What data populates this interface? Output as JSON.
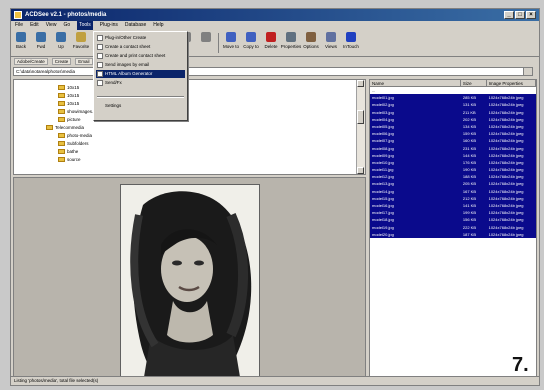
{
  "window": {
    "title": "ACDSee v2.1 - photos/media",
    "controls": [
      "_",
      "□",
      "×"
    ]
  },
  "menubar": [
    "File",
    "Edit",
    "View",
    "Go",
    "Tools",
    "Plug-ins",
    "Database",
    "Help"
  ],
  "toolbar": [
    {
      "label": "Back",
      "icon": "back-icon",
      "color": "#3a6ea5"
    },
    {
      "label": "Fwd",
      "icon": "forward-icon",
      "color": "#3a6ea5"
    },
    {
      "label": "Up",
      "icon": "up-icon",
      "color": "#3a6ea5"
    },
    {
      "label": "Favorite",
      "icon": "favorite-icon",
      "color": "#c0a040"
    },
    {
      "label": "View",
      "icon": "view-icon",
      "color": "#6080a0"
    },
    {
      "label": "",
      "icon": "icon",
      "color": "#808080"
    },
    {
      "label": "",
      "icon": "icon",
      "color": "#808080"
    },
    {
      "label": "",
      "icon": "icon",
      "color": "#808080"
    },
    {
      "label": "",
      "icon": "icon",
      "color": "#808080"
    },
    {
      "label": "",
      "icon": "icon",
      "color": "#808080"
    },
    {
      "label": "Move to",
      "icon": "move-to-icon",
      "color": "#4060c0"
    },
    {
      "label": "Copy to",
      "icon": "copy-to-icon",
      "color": "#4060c0"
    },
    {
      "label": "Delete",
      "icon": "delete-icon",
      "color": "#c02020"
    },
    {
      "label": "Properties",
      "icon": "properties-icon",
      "color": "#607080"
    },
    {
      "label": "Options",
      "icon": "options-icon",
      "color": "#806040"
    },
    {
      "label": "Views",
      "icon": "views-icon",
      "color": "#6070a0"
    },
    {
      "label": "InTouch",
      "icon": "intouch-icon",
      "color": "#2040c0"
    }
  ],
  "linkbar": [
    "Adobe/Create",
    "Create",
    "Email",
    "Print",
    "HTML",
    "Send/Fx"
  ],
  "address": {
    "value": "C:\\data\\notarealphotos\\media"
  },
  "tools_menu": {
    "items": [
      "Plug-in/Other Create",
      "Create a contact sheet",
      "Create and print contact sheet",
      "Send images by email",
      "HTML Album Generator",
      "Send/Fx",
      "Settings"
    ]
  },
  "tree": {
    "items": [
      "10x15",
      "10x15",
      "10x15",
      "showimages.com",
      "picture",
      "Telecommedia",
      "photo-media",
      "Subfolders",
      "bathe",
      "source"
    ]
  },
  "list": {
    "columns": [
      "Name",
      "Size",
      "Image Properties"
    ],
    "rows": [
      {
        "name": "...",
        "size": "",
        "props": ""
      },
      {
        "name": "model01.jpg",
        "size": "285 KB",
        "props": "1024x768x24b jpeg"
      },
      {
        "name": "model02.jpg",
        "size": "131 KB",
        "props": "1024x768x24b jpeg"
      },
      {
        "name": "model03.jpg",
        "size": "211 KB",
        "props": "1024x768x24b jpeg"
      },
      {
        "name": "model04.jpg",
        "size": "202 KB",
        "props": "1024x768x24b jpeg"
      },
      {
        "name": "model05.jpg",
        "size": "134 KB",
        "props": "1024x768x24b jpeg"
      },
      {
        "name": "model06.jpg",
        "size": "159 KB",
        "props": "1024x768x24b jpeg"
      },
      {
        "name": "model07.jpg",
        "size": "160 KB",
        "props": "1024x768x24b jpeg"
      },
      {
        "name": "model08.jpg",
        "size": "231 KB",
        "props": "1024x768x24b jpeg"
      },
      {
        "name": "model09.jpg",
        "size": "144 KB",
        "props": "1024x768x24b jpeg"
      },
      {
        "name": "model10.jpg",
        "size": "176 KB",
        "props": "1024x768x24b jpeg"
      },
      {
        "name": "model11.jpg",
        "size": "190 KB",
        "props": "1024x768x24b jpeg"
      },
      {
        "name": "model12.jpg",
        "size": "188 KB",
        "props": "1024x768x24b jpeg"
      },
      {
        "name": "model13.jpg",
        "size": "205 KB",
        "props": "1024x768x24b jpeg"
      },
      {
        "name": "model14.jpg",
        "size": "167 KB",
        "props": "1024x768x24b jpeg"
      },
      {
        "name": "model15.jpg",
        "size": "212 KB",
        "props": "1024x768x24b jpeg"
      },
      {
        "name": "model16.jpg",
        "size": "141 KB",
        "props": "1024x768x24b jpeg"
      },
      {
        "name": "model17.jpg",
        "size": "199 KB",
        "props": "1024x768x24b jpeg"
      },
      {
        "name": "model18.jpg",
        "size": "156 KB",
        "props": "1024x768x24b jpeg"
      },
      {
        "name": "model19.jpg",
        "size": "222 KB",
        "props": "1024x768x24b jpeg"
      },
      {
        "name": "model20.jpg",
        "size": "187 KB",
        "props": "1024x768x24b jpeg"
      }
    ]
  },
  "status": {
    "text": "Listing 'photos/media', total file selected(s)"
  },
  "step_number": "7.",
  "colors": {
    "title_start": "#0a246a",
    "title_end": "#3a6ea5",
    "selection": "#0a0a8c",
    "chrome": "#d4d0c8"
  }
}
